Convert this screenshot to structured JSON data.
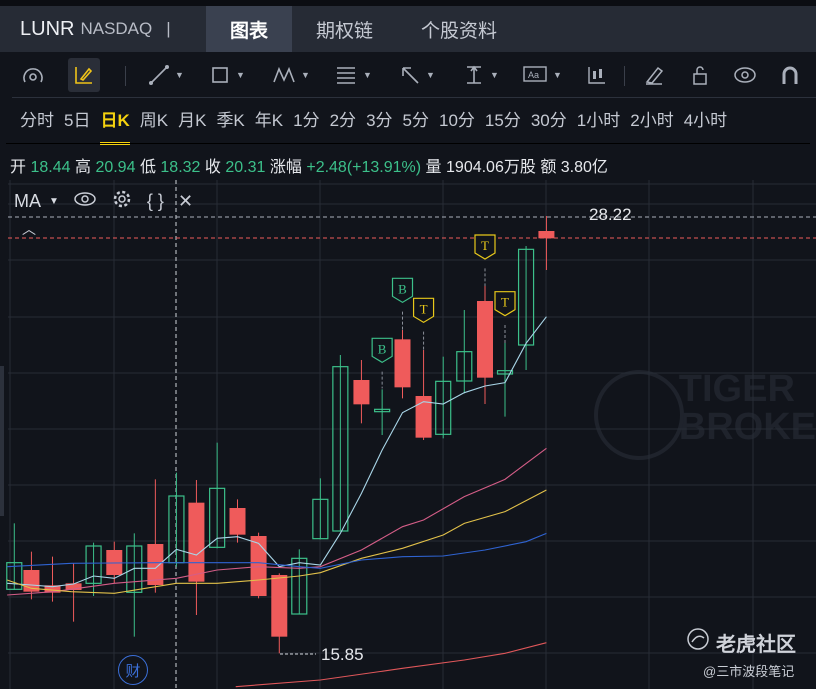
{
  "header": {
    "symbol": "LUNR",
    "exchange": "NASDAQ",
    "divider": "|",
    "tabs": [
      {
        "label": "图表",
        "active": true
      },
      {
        "label": "期权链"
      },
      {
        "label": "个股资料"
      }
    ]
  },
  "toolbar": {
    "icons": [
      "indicator-gauge-icon",
      "draw-pen-icon",
      "trend-line-icon",
      "rectangle-icon",
      "pattern-icon",
      "fibonacci-icon",
      "arrow-icon",
      "measure-icon",
      "text-annotation-icon",
      "candle-style-icon",
      "eraser-icon",
      "lock-icon",
      "visibility-icon",
      "magnet-icon"
    ]
  },
  "periods": [
    {
      "label": "分时"
    },
    {
      "label": "5日"
    },
    {
      "label": "日K",
      "active": true
    },
    {
      "label": "周K"
    },
    {
      "label": "月K"
    },
    {
      "label": "季K"
    },
    {
      "label": "年K"
    },
    {
      "label": "1分"
    },
    {
      "label": "2分"
    },
    {
      "label": "3分"
    },
    {
      "label": "5分"
    },
    {
      "label": "10分"
    },
    {
      "label": "15分"
    },
    {
      "label": "30分"
    },
    {
      "label": "1小时"
    },
    {
      "label": "2小时"
    },
    {
      "label": "4小时"
    }
  ],
  "quote": {
    "open_label": "开",
    "open": "18.44",
    "high_label": "高",
    "high": "20.94",
    "low_label": "低",
    "low": "18.32",
    "close_label": "收",
    "close": "20.31",
    "change_label": "涨幅",
    "change": "+2.48(+13.91%)",
    "volume_label": "量",
    "volume": "1904.06万股",
    "amount_label": "额",
    "amount": "3.80亿"
  },
  "indicator": {
    "name": "MA"
  },
  "chart": {
    "high_marker": "28.22",
    "low_marker": "15.85",
    "markers": [
      "B",
      "B",
      "T",
      "T",
      "T"
    ],
    "earnings_badge": "财",
    "colors": {
      "up": "#3cc08a",
      "down": "#ef5b5b",
      "ma5": "#a9d6e8",
      "ma10": "#d45d87",
      "ma20": "#e2c14a",
      "ma30": "#2f63d1",
      "ma60": "#e0575a"
    }
  },
  "watermark": {
    "line1": "TIGER",
    "line2": "BROKE"
  },
  "brand": {
    "name": "老虎社区",
    "author": "@三市波段笔记"
  }
}
